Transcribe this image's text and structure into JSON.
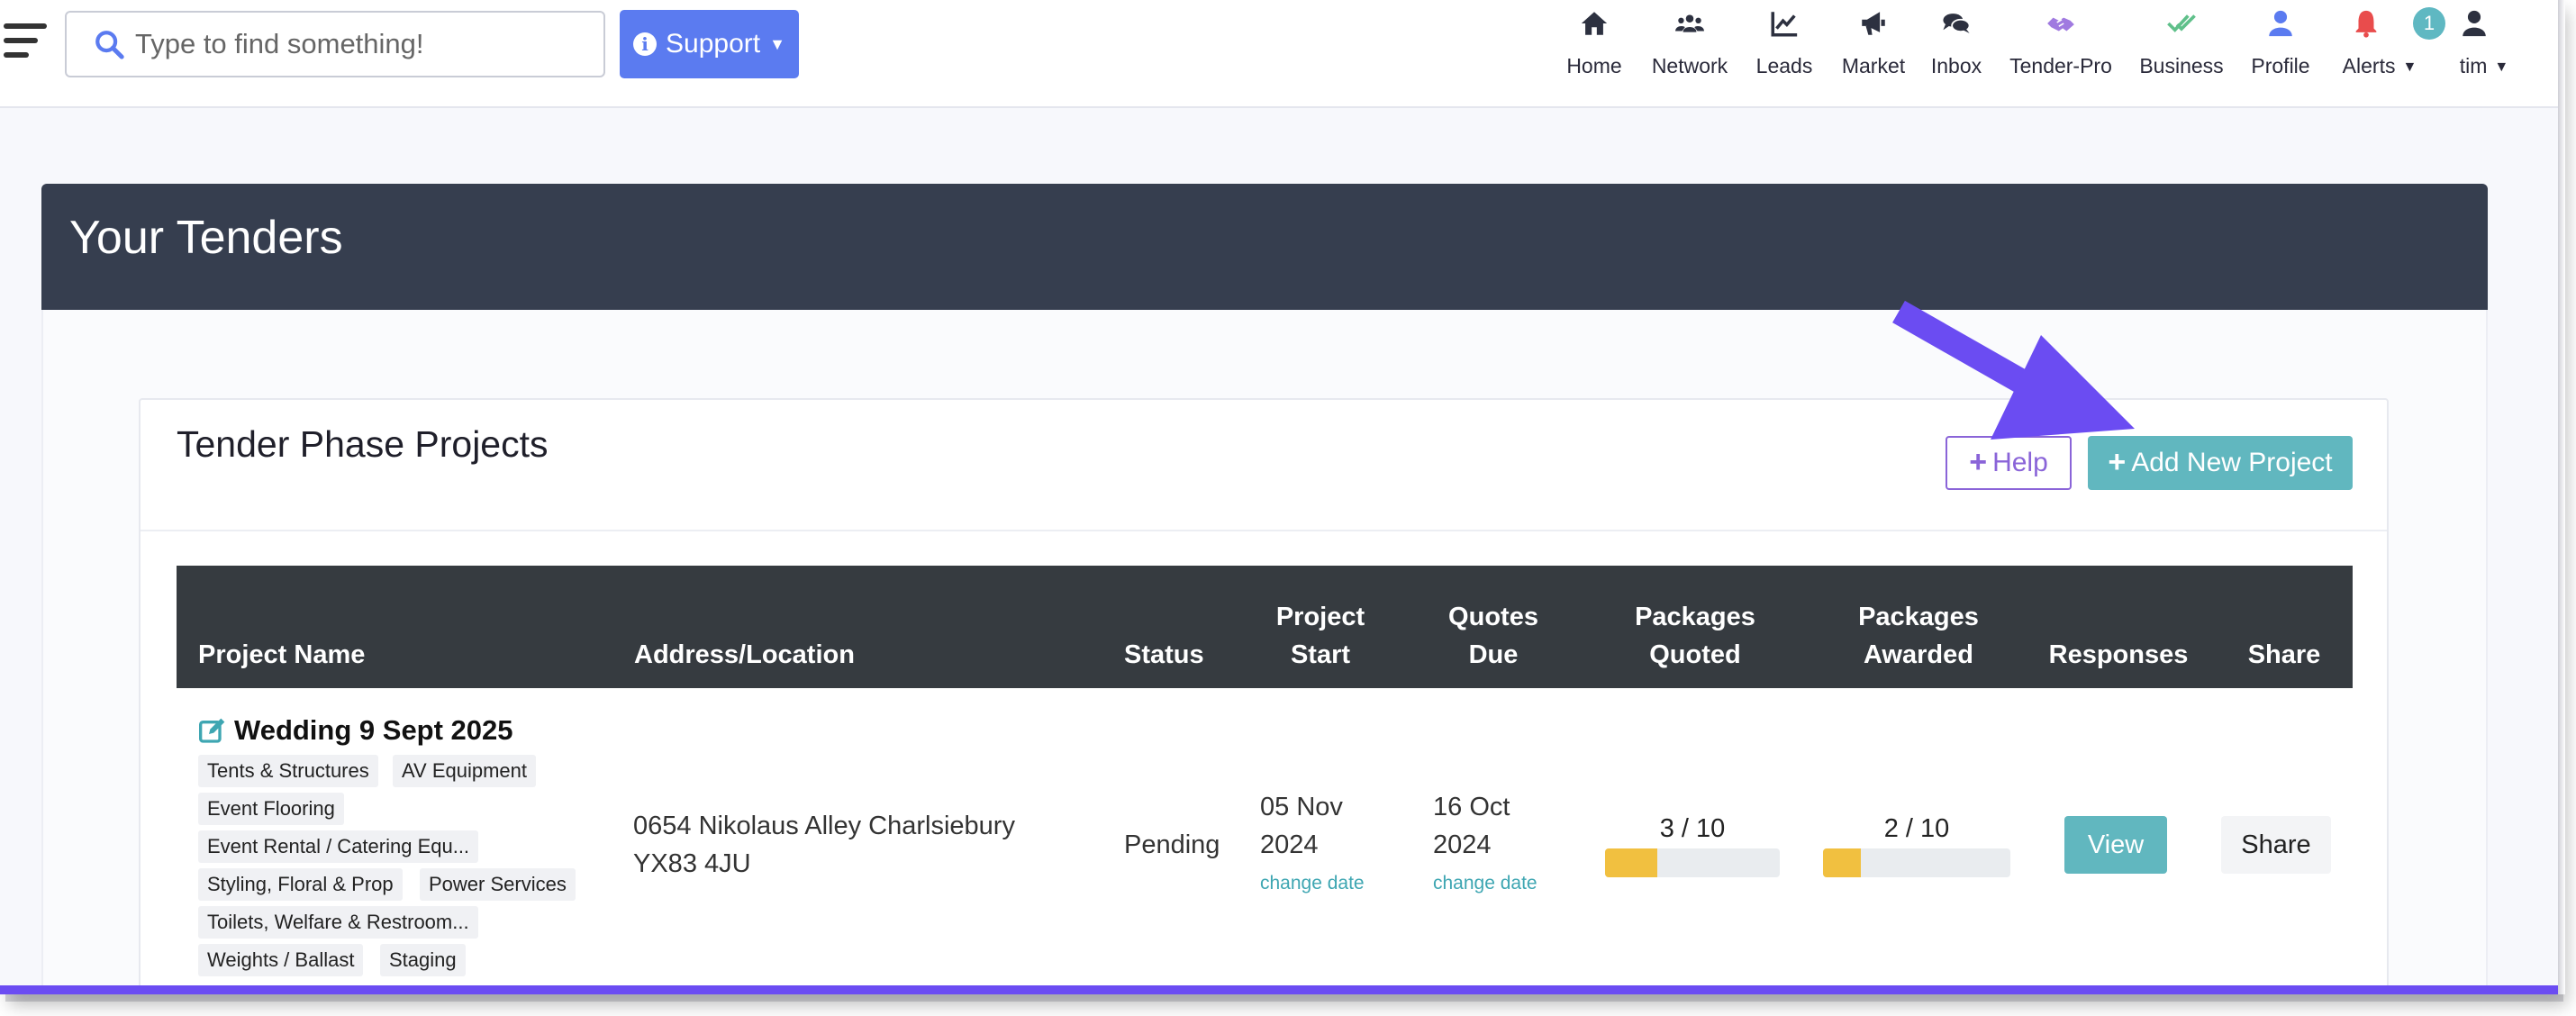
{
  "search": {
    "placeholder": "Type to find something!"
  },
  "support_button": {
    "label": "Support"
  },
  "nav": [
    {
      "label": "Home",
      "icon": "home-icon"
    },
    {
      "label": "Network",
      "icon": "network-icon"
    },
    {
      "label": "Leads",
      "icon": "leads-chart-icon"
    },
    {
      "label": "Market",
      "icon": "megaphone-icon"
    },
    {
      "label": "Inbox",
      "icon": "chat-icon"
    },
    {
      "label": "Tender-Pro",
      "icon": "handshake-icon"
    },
    {
      "label": "Business",
      "icon": "double-check-icon"
    },
    {
      "label": "Profile",
      "icon": "person-icon"
    },
    {
      "label": "Alerts",
      "icon": "bell-icon"
    },
    {
      "label": "tim",
      "icon": "user-icon"
    }
  ],
  "alerts_count": "1",
  "page_title": "Your Tenders",
  "section_title": "Tender Phase Projects",
  "buttons": {
    "help": "Help",
    "add_project": "Add New Project"
  },
  "table": {
    "headers": {
      "project_name": "Project Name",
      "address": "Address/Location",
      "status": "Status",
      "project_start_1": "Project",
      "project_start_2": "Start",
      "quotes_due_1": "Quotes",
      "quotes_due_2": "Due",
      "packages_quoted_1": "Packages",
      "packages_quoted_2": "Quoted",
      "packages_awarded_1": "Packages",
      "packages_awarded_2": "Awarded",
      "responses": "Responses",
      "share": "Share"
    },
    "rows": [
      {
        "name": "Wedding 9 Sept 2025",
        "tags": [
          "Tents & Structures",
          "AV Equipment",
          "Event Flooring",
          "Event Rental / Catering Equ...",
          "Styling, Floral & Prop",
          "Power Services",
          "Toilets, Welfare & Restroom...",
          "Weights / Ballast",
          "Staging"
        ],
        "address_line1": "0654 Nikolaus Alley Charlsiebury",
        "address_line2": "YX83 4JU",
        "status": "Pending",
        "project_start_1": "05 Nov",
        "project_start_2": "2024",
        "quotes_due_1": "16 Oct",
        "quotes_due_2": "2024",
        "change_date": "change date",
        "packages_quoted": "3 / 10",
        "packages_quoted_fraction": 0.3,
        "packages_awarded": "2 / 10",
        "packages_awarded_fraction": 0.2,
        "view_label": "View",
        "share_label": "Share"
      }
    ]
  },
  "colors": {
    "header_bg": "#363e4f",
    "table_head_bg": "#363b40",
    "teal": "#61b7bf",
    "support_blue": "#5b7bf0",
    "help_purple": "#8a64d8",
    "progress_yellow": "#f1c040",
    "annotation_arrow": "#6b4cf2"
  }
}
